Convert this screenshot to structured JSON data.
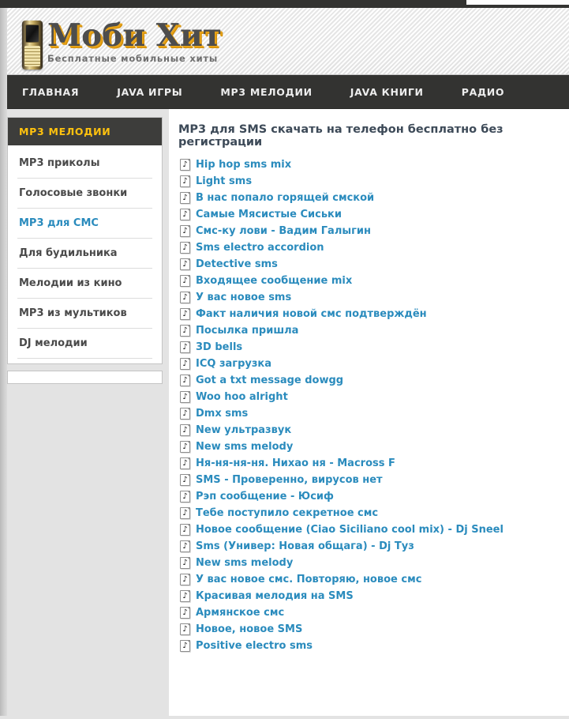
{
  "topbar": {
    "tab_label": ""
  },
  "brand": {
    "phone_icon": "mobile-phone-icon",
    "title": "Моби Хит",
    "tagline": "Бесплатные мобильные хиты"
  },
  "nav": {
    "items": [
      {
        "label": "ГЛАВНАЯ"
      },
      {
        "label": "JAVA ИГРЫ"
      },
      {
        "label": "MP3 МЕЛОДИИ"
      },
      {
        "label": "JAVA КНИГИ"
      },
      {
        "label": "РАДИО"
      }
    ]
  },
  "sidebar": {
    "heading": "MP3 МЕЛОДИИ",
    "items": [
      {
        "label": "MP3 приколы",
        "active": false
      },
      {
        "label": "Голосовые звонки",
        "active": false
      },
      {
        "label": "MP3 для СМС",
        "active": true
      },
      {
        "label": "Для будильника",
        "active": false
      },
      {
        "label": "Мелодии из кино",
        "active": false
      },
      {
        "label": "MP3 из мультиков",
        "active": false
      },
      {
        "label": "DJ мелодии",
        "active": false
      }
    ]
  },
  "main": {
    "title": "MP3 для SMS скачать на телефон бесплатно без регистрации",
    "track_icon": "mp3-file-icon",
    "track_icon_glyph": "♪",
    "tracks": [
      {
        "label": "Hip hop sms mix"
      },
      {
        "label": "Light sms"
      },
      {
        "label": "В нас попало горящей смской"
      },
      {
        "label": "Самые Мясистые Сиськи"
      },
      {
        "label": "Смс-ку лови - Вадим Галыгин"
      },
      {
        "label": "Sms electro accordion"
      },
      {
        "label": "Detective sms"
      },
      {
        "label": "Входящее сообщение mix"
      },
      {
        "label": "У вас новое sms"
      },
      {
        "label": "Факт наличия новой смс подтверждён"
      },
      {
        "label": "Посылка пришла"
      },
      {
        "label": "3D bells"
      },
      {
        "label": "ICQ загрузка"
      },
      {
        "label": "Got a txt message dowgg"
      },
      {
        "label": "Woo hoo alright"
      },
      {
        "label": "Dmx sms"
      },
      {
        "label": "New ультразвук"
      },
      {
        "label": "New sms melody"
      },
      {
        "label": "Ня-ня-ня-ня. Нихао ня - Macross F"
      },
      {
        "label": "SMS - Проверенно, вирусов нет"
      },
      {
        "label": "Рэп сообщение - Юсиф"
      },
      {
        "label": "Тебе поступило секретное смс"
      },
      {
        "label": "Новое сообщение (Ciao Siciliano cool mix) - Dj Sneel"
      },
      {
        "label": "Sms (Универ: Новая общага) - Dj Туз"
      },
      {
        "label": "New sms melody"
      },
      {
        "label": "У вас новое смс. Повторяю, новое смс"
      },
      {
        "label": "Красивая мелодия на SMS"
      },
      {
        "label": "Армянское смс"
      },
      {
        "label": "Новое, новое SMS"
      },
      {
        "label": "Positive electro sms"
      }
    ]
  },
  "colors": {
    "nav_bg": "#333331",
    "accent_gold": "#ffc20e",
    "link_blue": "#2a8bbd",
    "page_bg": "#e3e3e3",
    "heading_slate": "#3d4a58"
  }
}
